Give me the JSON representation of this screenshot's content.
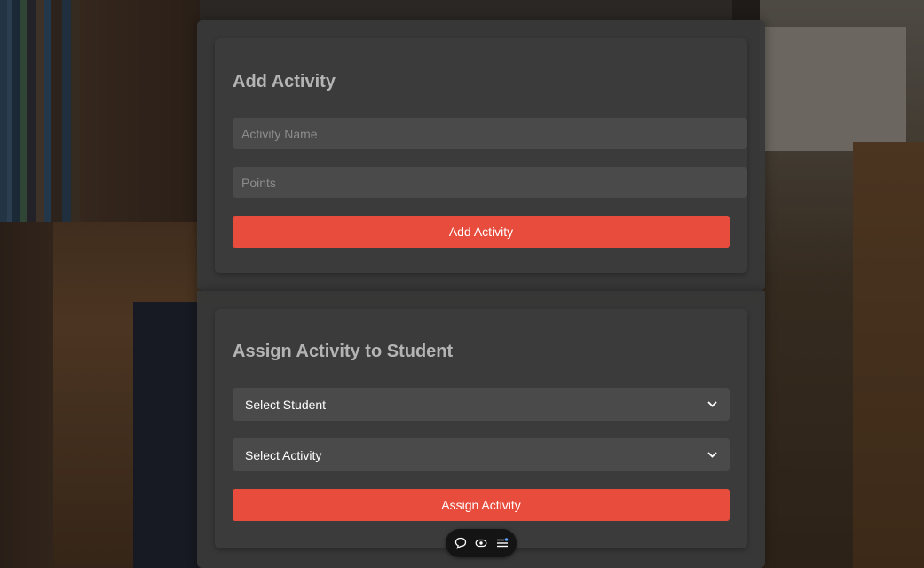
{
  "add_activity": {
    "title": "Add Activity",
    "activity_name_placeholder": "Activity Name",
    "activity_name_value": "",
    "points_placeholder": "Points",
    "points_value": "",
    "submit_label": "Add Activity"
  },
  "assign_activity": {
    "title": "Assign Activity to Student",
    "student_select": {
      "selected": "Select Student"
    },
    "activity_select": {
      "selected": "Select Activity"
    },
    "submit_label": "Assign Activity"
  },
  "toolbar": {
    "icons": [
      "comment-icon",
      "eye-icon",
      "menu-icon"
    ]
  },
  "colors": {
    "accent": "#e74c3c",
    "card": "#3b3b3b",
    "input": "#4a4a4a",
    "heading": "#b4b4b4"
  }
}
